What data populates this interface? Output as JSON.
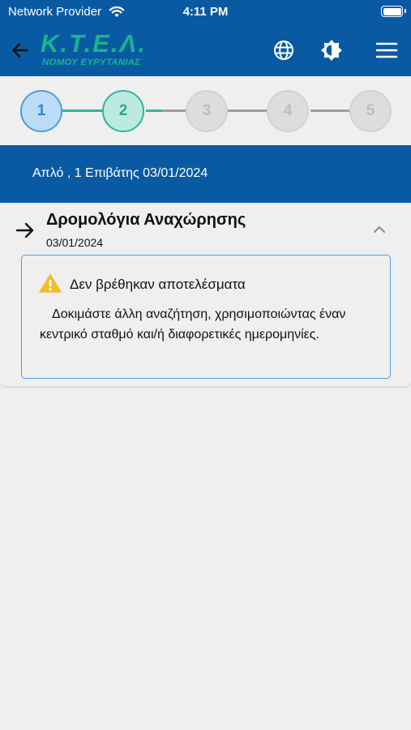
{
  "status_bar": {
    "carrier": "Network Provider",
    "time": "4:11 PM"
  },
  "header": {
    "logo_main": "Κ.Τ.Ε.Λ.",
    "logo_sub": "ΝΟΜΟΥ ΕΥΡΥΤΑΝΙΑΣ",
    "icons": [
      "back-arrow-icon",
      "globe-icon",
      "brightness-icon",
      "menu-icon"
    ]
  },
  "stepper": {
    "steps": [
      "1",
      "2",
      "3",
      "4",
      "5"
    ],
    "current_step": 2
  },
  "summary": {
    "text": "Απλό , 1 Επιβάτης  03/01/2024"
  },
  "departures": {
    "title": "Δρομολόγια Αναχώρησης",
    "date": "03/01/2024",
    "alert_title": "Δεν βρέθηκαν αποτελέσματα",
    "alert_message": "Δοκιμάστε άλλη αναζήτηση, χρησιμοποιώντας έναν κεντρικό σταθμό και/ή διαφορετικές ημερομηνίες."
  },
  "colors": {
    "header_blue": "#0a5aa3",
    "logo_green": "#19b48f",
    "step_done_blue": "#4a9ee3",
    "step_current_teal": "#2fb69a",
    "warning_yellow": "#f3bd2f"
  }
}
